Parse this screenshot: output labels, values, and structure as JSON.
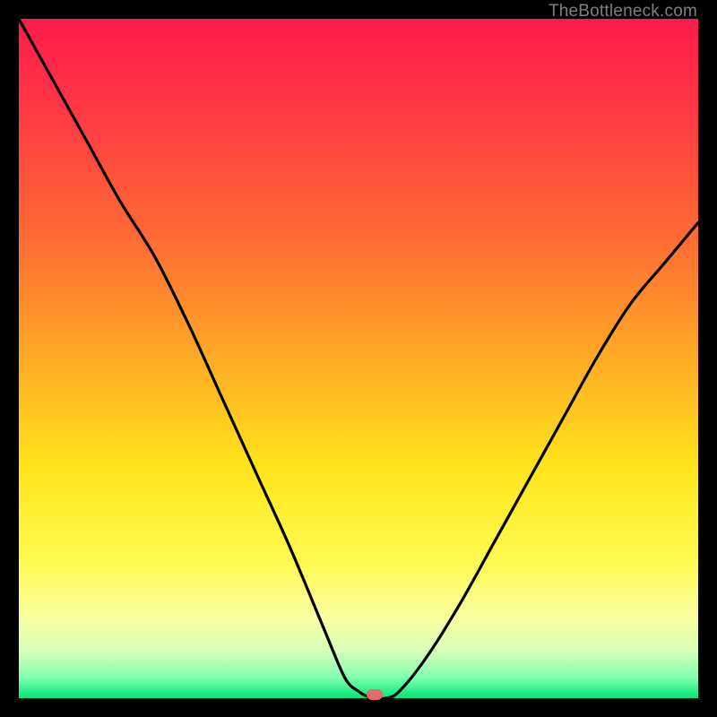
{
  "attribution": "TheBottleneck.com",
  "marker": {
    "color": "#e66a6a",
    "x_frac": 0.524,
    "y_frac": 0.995
  },
  "chart_data": {
    "type": "line",
    "title": "",
    "xlabel": "",
    "ylabel": "",
    "xlim": [
      0,
      100
    ],
    "ylim": [
      0,
      100
    ],
    "grid": false,
    "legend": false,
    "series": [
      {
        "name": "bottleneck-curve",
        "x": [
          0,
          5,
          10,
          15,
          20,
          25,
          30,
          35,
          40,
          45,
          48,
          50,
          52,
          54,
          56,
          60,
          65,
          70,
          75,
          80,
          85,
          90,
          95,
          100
        ],
        "y": [
          100,
          91,
          82,
          73,
          65,
          55,
          44,
          33,
          22,
          10,
          3,
          1,
          0,
          0,
          1,
          6,
          14,
          23,
          32,
          41,
          50,
          58,
          64,
          70
        ]
      }
    ],
    "gradient_stops": [
      {
        "pos": 0.0,
        "color": "#ff1a4b"
      },
      {
        "pos": 0.14,
        "color": "#ff3a44"
      },
      {
        "pos": 0.32,
        "color": "#ff6a33"
      },
      {
        "pos": 0.49,
        "color": "#ffa727"
      },
      {
        "pos": 0.66,
        "color": "#ffe41a"
      },
      {
        "pos": 0.8,
        "color": "#fffb52"
      },
      {
        "pos": 0.88,
        "color": "#fbffa0"
      },
      {
        "pos": 0.93,
        "color": "#d8ffb8"
      },
      {
        "pos": 0.97,
        "color": "#7fffb0"
      },
      {
        "pos": 1.0,
        "color": "#00e676"
      }
    ],
    "marker_point": {
      "x": 52.4,
      "y": 0
    }
  }
}
